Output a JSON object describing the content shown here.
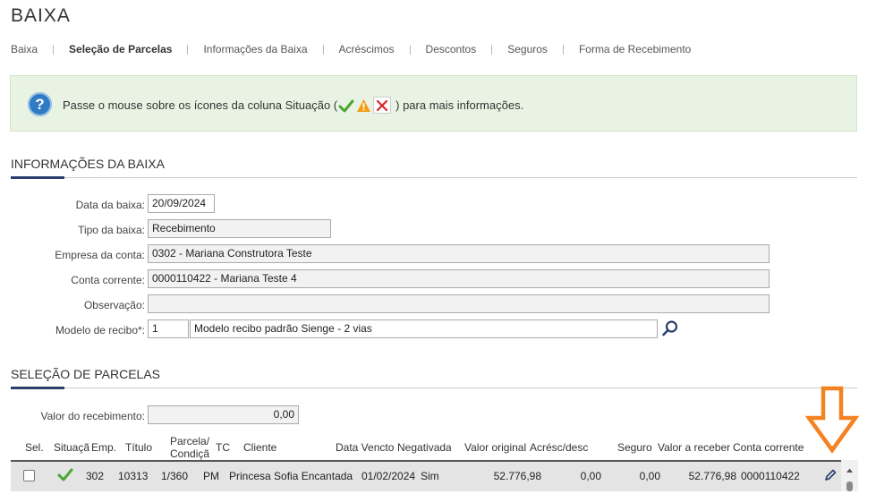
{
  "page": {
    "title": "BAIXA"
  },
  "tabs": [
    {
      "label": "Baixa"
    },
    {
      "label": "Seleção de Parcelas"
    },
    {
      "label": "Informações da Baixa"
    },
    {
      "label": "Acréscimos"
    },
    {
      "label": "Descontos"
    },
    {
      "label": "Seguros"
    },
    {
      "label": "Forma de Recebimento"
    }
  ],
  "info": {
    "text_before": "Passe o mouse sobre os ícones da coluna Situação (",
    "text_after": ") para mais informações."
  },
  "informacoes": {
    "title": "INFORMAÇÕES DA BAIXA",
    "data_label": "Data da baixa:",
    "data_value": "20/09/2024",
    "tipo_label": "Tipo da baixa:",
    "tipo_value": "Recebimento",
    "empresa_label": "Empresa da conta:",
    "empresa_value": "0302 - Mariana Construtora Teste",
    "conta_label": "Conta corrente:",
    "conta_value": "0000110422 - Mariana Teste 4",
    "obs_label": "Observação:",
    "obs_value": "",
    "modelo_label": "Modelo de recibo*:",
    "modelo_code": "1",
    "modelo_name": "Modelo recibo padrão Sienge - 2 vias"
  },
  "selecao": {
    "title": "SELEÇÃO DE PARCELAS",
    "valor_label": "Valor do recebimento:",
    "valor_value": "0,00",
    "columns": {
      "sel": "Sel.",
      "situacao": "Situaçã",
      "emp": "Emp.",
      "titulo": "Título",
      "parcela1": "Parcela/",
      "parcela2": "Condiçã",
      "tc": "TC",
      "cliente": "Cliente",
      "data_vencto": "Data Vencto",
      "negativada": "Negativada",
      "valor_original": "Valor original",
      "acresc": "Acrésc/desc",
      "seguro": "Seguro",
      "valor_receber": "Valor a receber",
      "conta_corrente": "Conta corrente"
    },
    "row": {
      "emp": "302",
      "titulo": "10313",
      "parcela": "1/360",
      "tc": "PM",
      "cliente": "Princesa Sofia Encantada",
      "data_vencto": "01/02/2024",
      "negativada": "Sim",
      "valor_original": "52.776,98",
      "acresc": "0,00",
      "seguro": "0,00",
      "valor_receber": "52.776,98",
      "conta_corrente": "0000110422"
    }
  },
  "colors": {
    "accent": "#2a3f6e",
    "info_bg": "#e9f3e4",
    "check": "#4aa832",
    "warning": "#f39c12",
    "error": "#d9262c",
    "highlight_arrow": "#f58220"
  }
}
